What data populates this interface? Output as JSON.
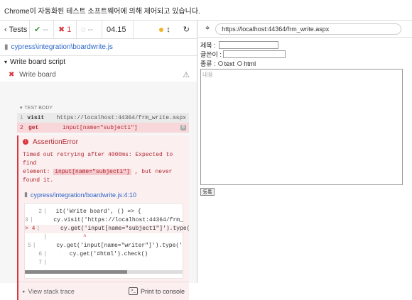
{
  "infobar": {
    "message": "Chrome이 자동화된 테스트 소프트웨어에 의해 제어되고 있습니다."
  },
  "runner": {
    "back_label": "Tests",
    "passed": "--",
    "failed": "1",
    "pending": "--",
    "duration": "04.15",
    "spec_path": "cypress\\integration\\boardwrite.js",
    "suite_title": "Write board script",
    "test_title": "Write board",
    "test_body_label": "TEST BODY",
    "commands": [
      {
        "no": "1",
        "name": "visit",
        "message": "https://localhost:44364/frm_write.aspx"
      },
      {
        "no": "2",
        "name": "get",
        "message": "input[name=\"subject1\"]",
        "badge": "0"
      }
    ],
    "error": {
      "title": "AssertionError",
      "message_part1": "Timed out retrying after 4000ms: Expected to find",
      "message_part2": "element:",
      "selector": "input[name=\"subject1\"]",
      "message_part3": ", but never found it.",
      "file_link": "cypress/integration/boardwrite.js:4:10",
      "code_lines": [
        {
          "no": "2",
          "marker": "",
          "text": "  it('Write board', () => {"
        },
        {
          "no": "3",
          "marker": "",
          "text": "      cy.visit('https://localhost:44364/frm_"
        },
        {
          "no": "4",
          "marker": ">",
          "text": "      cy.get('input[name=\"subject1\"]').type("
        },
        {
          "no": "",
          "marker": "",
          "text": "          ^"
        },
        {
          "no": "5",
          "marker": "",
          "text": "      cy.get('input[name=\"writer\"]').type('"
        },
        {
          "no": "6",
          "marker": "",
          "text": "      cy.get('#html').check()"
        },
        {
          "no": "7",
          "marker": "",
          "text": ""
        }
      ],
      "stack_trace_label": "View stack trace",
      "print_label": "Print to console"
    }
  },
  "aut": {
    "url": "https://localhost:44364/frm_write.aspx",
    "form": {
      "subject_label": "제목 :",
      "writer_label": "글쓴이 :",
      "type_label": "종류 :",
      "radio_text": "text",
      "radio_html": "html",
      "content_placeholder": "내용",
      "submit_label": "등록"
    }
  },
  "colors": {
    "error": "#d9363e",
    "pass": "#3a9a3a",
    "link": "#2b66c9",
    "pending_dot": "#f0b429"
  }
}
